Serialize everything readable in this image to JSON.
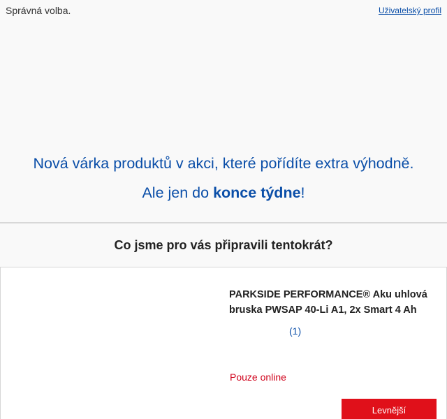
{
  "header": {
    "tagline": "Správná volba.",
    "profile_link": "Uživatelský profil"
  },
  "hero": {
    "line1": "Nová várka produktů v akci, které pořídíte extra výhodně.",
    "line2_prefix": "Ale jen do ",
    "line2_bold": "konce týdne",
    "line2_suffix": "!"
  },
  "section": {
    "title": "Co jsme pro vás připravili tentokrát?"
  },
  "product": {
    "title": "PARKSIDE PERFORMANCE® Aku uhlová bruska PWSAP 40-Li A1, 2x Smart 4 Ah",
    "rating_count": "(1)",
    "availability": "Pouze online",
    "button_label": "Levnější"
  },
  "colors": {
    "brand_blue": "#0a4ea8",
    "accent_red": "#e0101a",
    "online_red": "#d0021b"
  }
}
